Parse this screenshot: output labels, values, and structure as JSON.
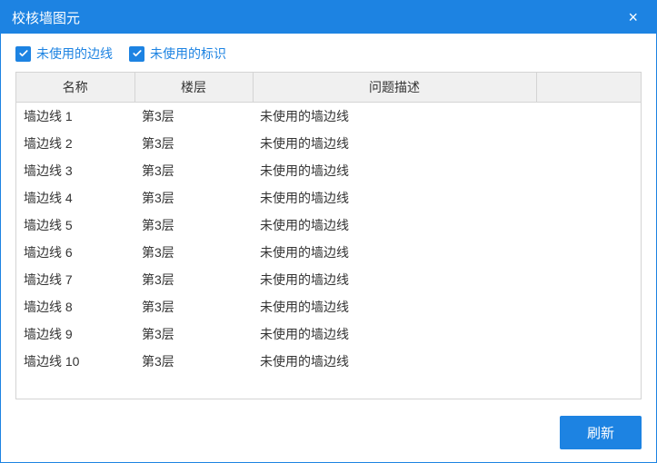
{
  "titlebar": {
    "title": "校核墙图元",
    "close_label": "×"
  },
  "checkboxes": {
    "unused_edge": {
      "label": "未使用的边线",
      "checked": true
    },
    "unused_mark": {
      "label": "未使用的标识",
      "checked": true
    }
  },
  "table": {
    "headers": {
      "name": "名称",
      "floor": "楼层",
      "issue": "问题描述",
      "extra": ""
    },
    "rows": [
      {
        "name": "墙边线 1",
        "floor": "第3层",
        "issue": "未使用的墙边线"
      },
      {
        "name": "墙边线 2",
        "floor": "第3层",
        "issue": "未使用的墙边线"
      },
      {
        "name": "墙边线 3",
        "floor": "第3层",
        "issue": "未使用的墙边线"
      },
      {
        "name": "墙边线 4",
        "floor": "第3层",
        "issue": "未使用的墙边线"
      },
      {
        "name": "墙边线 5",
        "floor": "第3层",
        "issue": "未使用的墙边线"
      },
      {
        "name": "墙边线 6",
        "floor": "第3层",
        "issue": "未使用的墙边线"
      },
      {
        "name": "墙边线 7",
        "floor": "第3层",
        "issue": "未使用的墙边线"
      },
      {
        "name": "墙边线 8",
        "floor": "第3层",
        "issue": "未使用的墙边线"
      },
      {
        "name": "墙边线 9",
        "floor": "第3层",
        "issue": "未使用的墙边线"
      },
      {
        "name": "墙边线 10",
        "floor": "第3层",
        "issue": "未使用的墙边线"
      }
    ]
  },
  "footer": {
    "refresh_label": "刷新"
  }
}
